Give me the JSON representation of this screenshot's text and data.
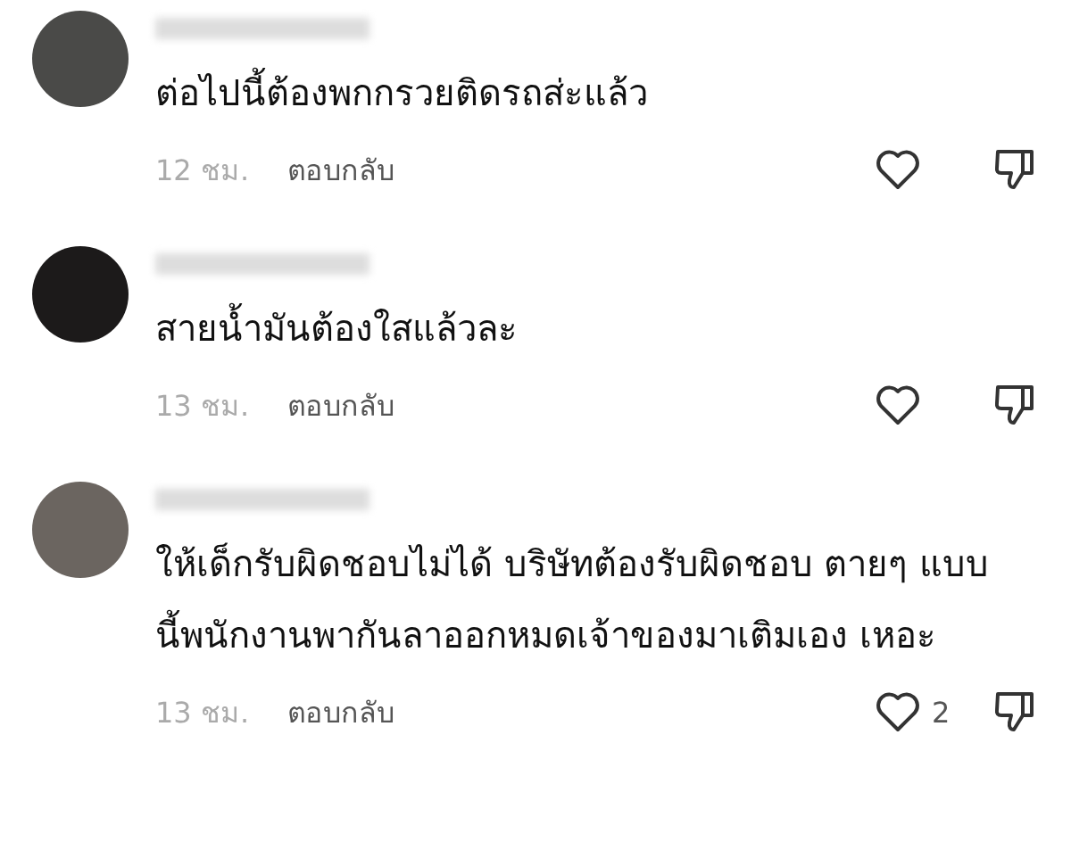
{
  "comments": [
    {
      "text": "ต่อไปนี้ต้องพกกรวยติดรถส่ะแล้ว",
      "time": "12 ชม.",
      "reply": "ตอบกลับ"
    },
    {
      "text": "สายน้ำมันต้องใสแล้วละ",
      "time": "13 ชม.",
      "reply": "ตอบกลับ"
    },
    {
      "text": "ให้เด็กรับผิดชอบไม่ได้ บริษัทต้องรับผิดชอบ ตายๆ แบบนี้พนักงานพากันลาออกหมดเจ้าของมาเติมเอง เหอะ",
      "time": "13 ชม.",
      "reply": "ตอบกลับ",
      "likes": "2"
    }
  ]
}
